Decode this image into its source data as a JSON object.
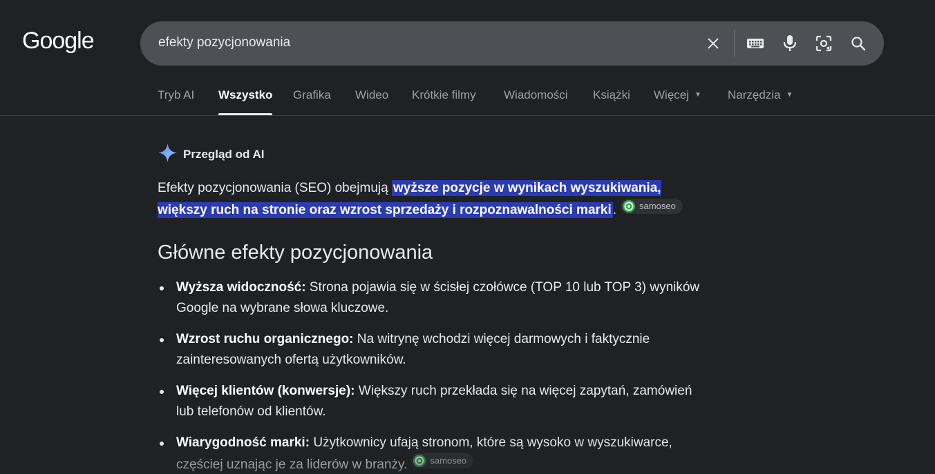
{
  "logo": "Google",
  "search": {
    "query": "efekty pozycjonowania",
    "icons": [
      "close-icon",
      "keyboard-icon",
      "mic-icon",
      "lens-icon",
      "search-icon"
    ]
  },
  "tabs": [
    {
      "label": "Tryb AI"
    },
    {
      "label": "Wszystko",
      "active": true
    },
    {
      "label": "Grafika"
    },
    {
      "label": "Wideo"
    },
    {
      "label": "Krótkie filmy"
    },
    {
      "label": "Wiadomości"
    },
    {
      "label": "Książki"
    },
    {
      "label": "Więcej"
    },
    {
      "label": "Narzędzia"
    }
  ],
  "ai_overview": {
    "title": "Przegląd od AI",
    "intro_plain": "Efekty pozycjonowania (SEO) obejmują ",
    "intro_highlight": "wyższe pozycje w wynikach wyszukiwania, większy ruch na stronie oraz wzrost sprzedaży i rozpoznawalności marki",
    "intro_end": ".",
    "source": "samoseo",
    "section_title": "Główne efekty pozycjonowania",
    "bullets": [
      {
        "bold": "Wyższa widoczność:",
        "text": " Strona pojawia się w ścisłej czołówce (TOP 10 lub TOP 3) wyników Google na wybrane słowa kluczowe."
      },
      {
        "bold": "Wzrost ruchu organicznego:",
        "text": " Na witrynę wchodzi więcej darmowych i faktycznie zainteresowanych ofertą użytkowników."
      },
      {
        "bold": "Więcej klientów (konwersje):",
        "text": " Większy ruch przekłada się na więcej zapytań, zamówień lub telefonów od klientów."
      },
      {
        "bold": "Wiarygodność marki:",
        "text": " Użytkownicy ufają stronom, które są wysoko w wyszukiwarce, częściej uznając je za liderów w branży.",
        "source": "samoseo"
      }
    ]
  },
  "colors": {
    "background": "#202124",
    "searchbar": "#4d5156",
    "highlight": "#2b3bb0",
    "text": "#e8eaed",
    "muted": "#9aa0a6"
  }
}
